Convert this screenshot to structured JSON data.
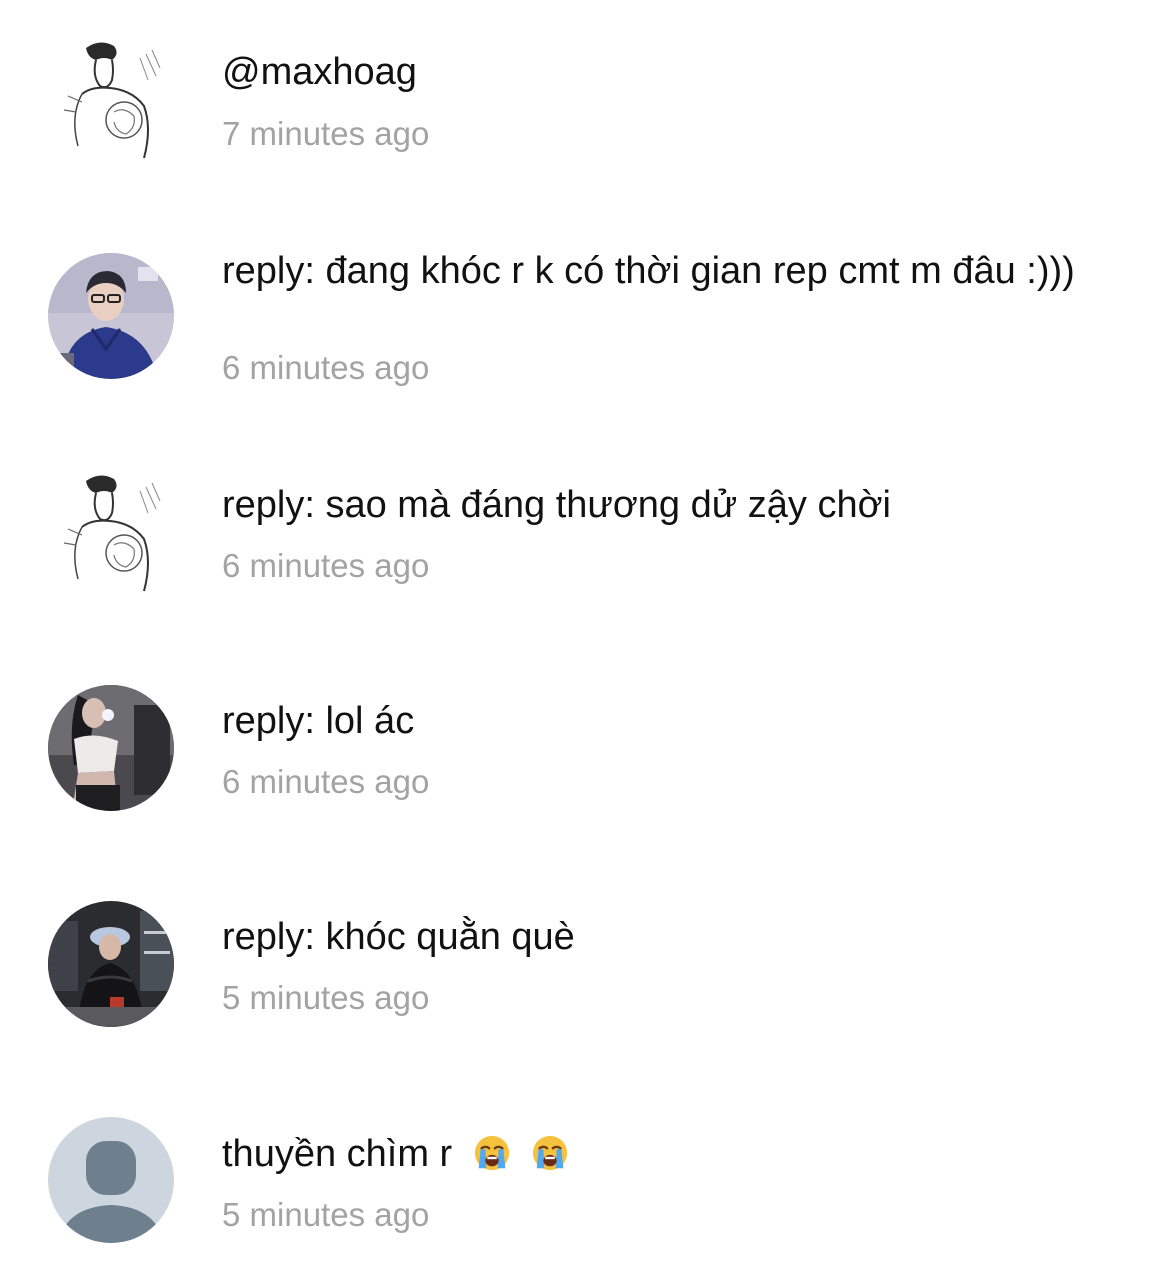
{
  "comments": [
    {
      "avatar_icon": "sketch-avatar-icon",
      "text": "@maxhoag",
      "time": "7 minutes ago"
    },
    {
      "avatar_icon": "photo-avatar-icon",
      "text": "reply: đang khóc r k có thời gian rep cmt m đâu :)))",
      "time": "6 minutes ago"
    },
    {
      "avatar_icon": "sketch-avatar-icon",
      "text": "reply: sao mà đáng thương dử zậy chời",
      "time": "6 minutes ago"
    },
    {
      "avatar_icon": "photo-avatar-icon",
      "text": "reply: lol ác",
      "time": "6 minutes ago"
    },
    {
      "avatar_icon": "photo-avatar-icon",
      "text": "reply: khóc quằn què",
      "time": "5 minutes ago"
    },
    {
      "avatar_icon": "default-user-avatar-icon",
      "text": "thuyền chìm r",
      "emojis": [
        "loudly-crying-face-emoji",
        "loudly-crying-face-emoji"
      ],
      "time": "5 minutes ago"
    }
  ],
  "colors": {
    "text": "#111111",
    "timestamp": "#a3a3a3",
    "default_avatar_bg": "#cdd6de",
    "default_avatar_fg": "#6e7f8e"
  }
}
